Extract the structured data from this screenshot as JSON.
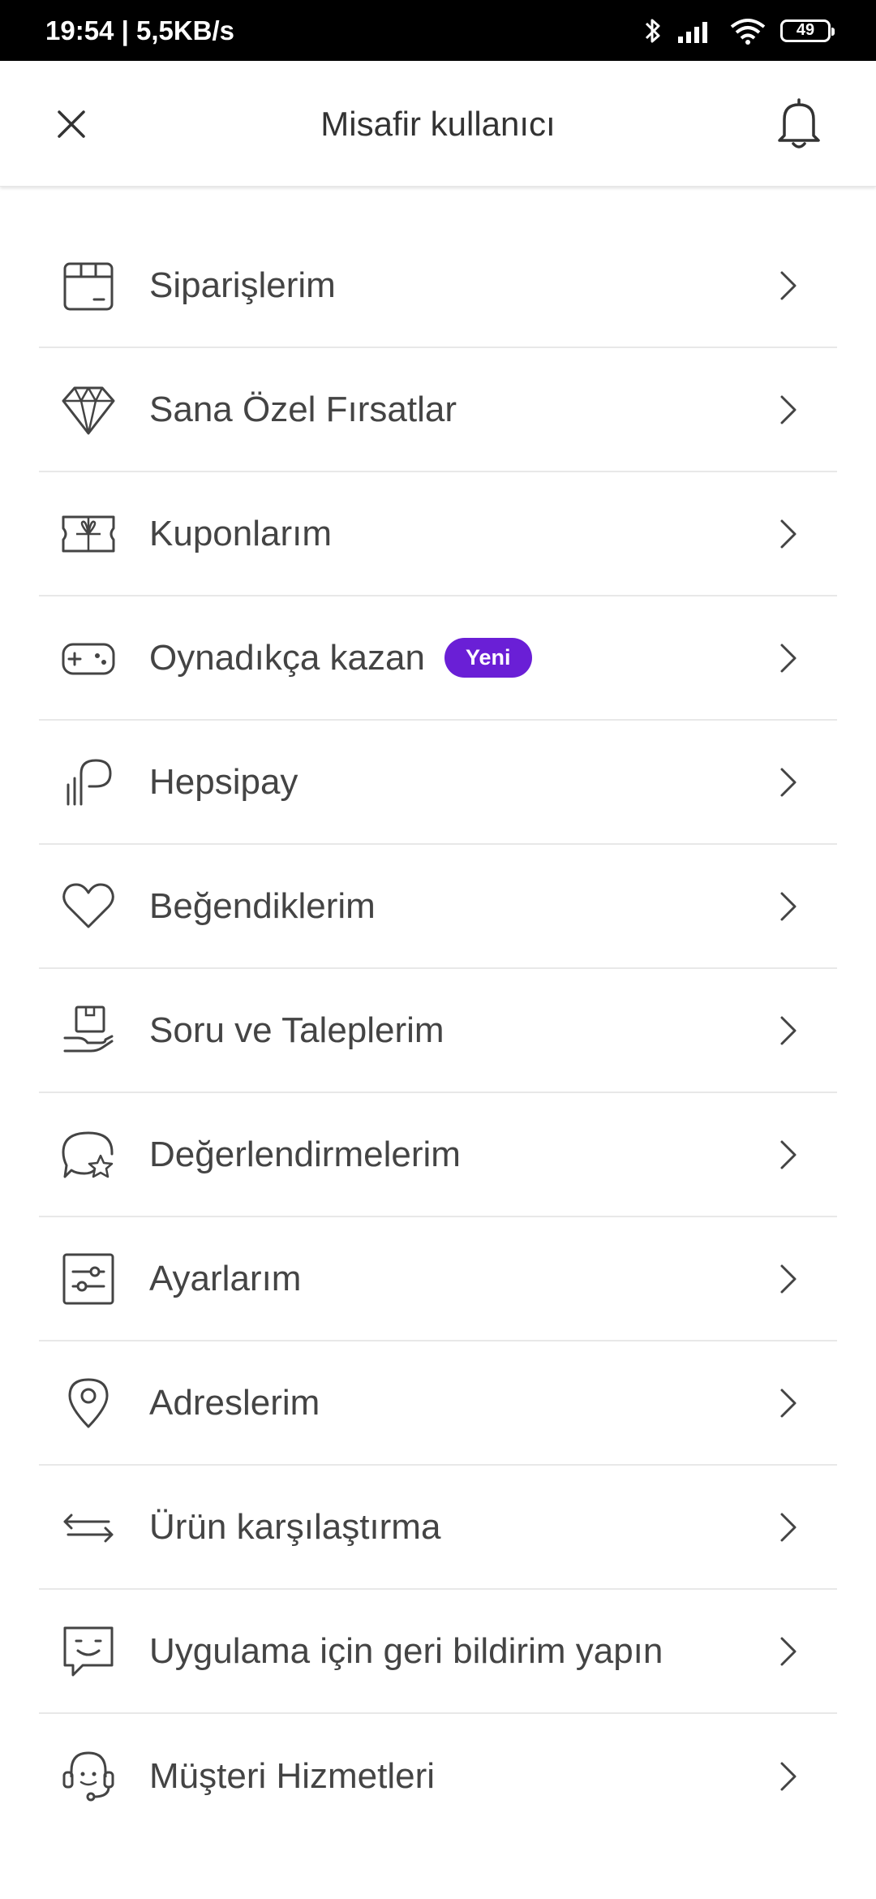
{
  "status_bar": {
    "time_speed": "19:54 | 5,5KB/s",
    "battery_level": "49",
    "icons": [
      "bluetooth-icon",
      "signal-icon",
      "wifi-icon",
      "battery-icon"
    ]
  },
  "header": {
    "title": "Misafir kullanıcı",
    "left_icon": "close-icon",
    "right_icon": "bell-icon"
  },
  "menu": {
    "items": [
      {
        "label": "Siparişlerim",
        "icon": "box-icon"
      },
      {
        "label": "Sana Özel Fırsatlar",
        "icon": "diamond-icon"
      },
      {
        "label": "Kuponlarım",
        "icon": "coupon-icon"
      },
      {
        "label": "Oynadıkça kazan",
        "icon": "gamepad-icon",
        "badge": "Yeni"
      },
      {
        "label": "Hepsipay",
        "icon": "hepsipay-icon"
      },
      {
        "label": "Beğendiklerim",
        "icon": "heart-icon"
      },
      {
        "label": "Soru ve Taleplerim",
        "icon": "hand-box-icon"
      },
      {
        "label": "Değerlendirmelerim",
        "icon": "review-star-icon"
      },
      {
        "label": "Ayarlarım",
        "icon": "settings-sliders-icon"
      },
      {
        "label": "Adreslerim",
        "icon": "location-pin-icon"
      },
      {
        "label": "Ürün karşılaştırma",
        "icon": "compare-arrows-icon"
      },
      {
        "label": "Uygulama için geri bildirim yapın",
        "icon": "feedback-icon"
      },
      {
        "label": "Müşteri Hizmetleri",
        "icon": "headset-icon"
      }
    ]
  },
  "colors": {
    "badge": "#6a1fd6",
    "text": "#444444",
    "divider": "#e8e8e8",
    "status_bar_bg": "#000000"
  }
}
